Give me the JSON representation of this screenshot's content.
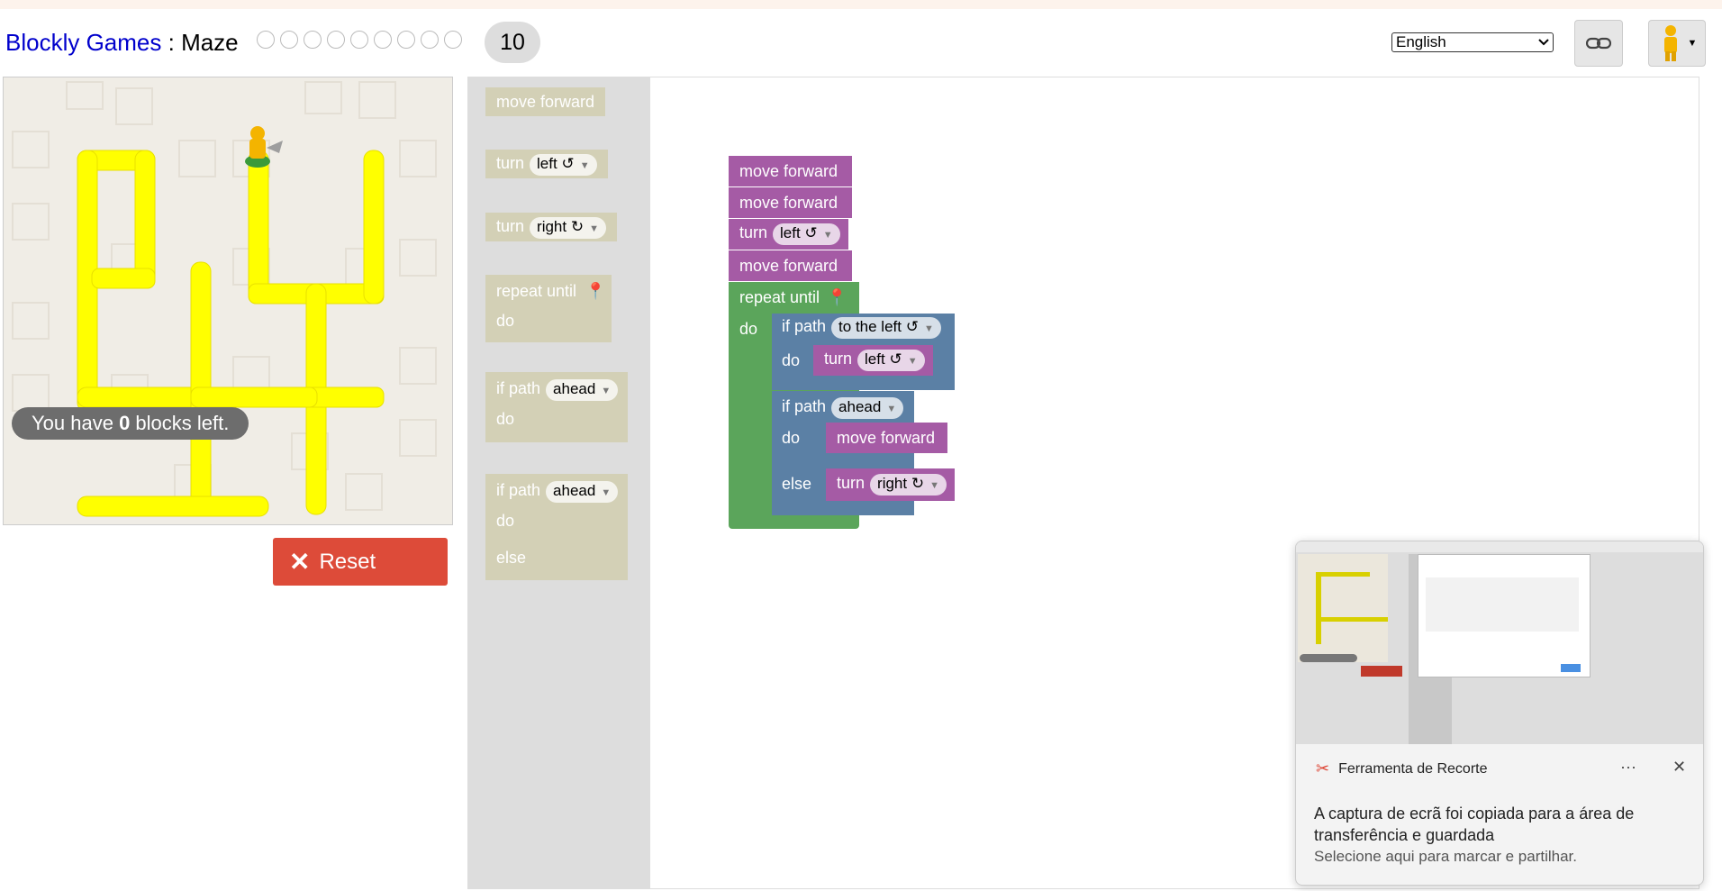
{
  "header": {
    "app_link": "Blockly Games",
    "separator": " : ",
    "game": "Maze",
    "level_dots": [
      "1",
      "2",
      "3",
      "4",
      "5",
      "6",
      "7",
      "8",
      "9"
    ],
    "current_level": "10",
    "language": "English",
    "link_icon": "link-icon",
    "pegman_icon": "pegman-icon"
  },
  "maze": {
    "blocks_left_prefix": "You have ",
    "blocks_left_count": "0",
    "blocks_left_suffix": " blocks left.",
    "reset_label": "Reset",
    "path_color": "#ffff00",
    "background_color": "#f0ede6"
  },
  "toolbox": {
    "move_forward": "move forward",
    "turn": "turn",
    "left": "left ↺",
    "right": "right ↻",
    "repeat_until": "repeat until",
    "do": "do",
    "if_path": "if path",
    "ahead": "ahead",
    "else": "else"
  },
  "program": {
    "move_forward_1": "move forward",
    "move_forward_2": "move forward",
    "turn_label": "turn",
    "turn_dir": "left ↺",
    "move_forward_3": "move forward",
    "repeat_until": "repeat until",
    "do": "do",
    "if1_label": "if path",
    "if1_dir": "to the left ↺",
    "if1_do": "do",
    "if1_turn": "turn",
    "if1_turn_dir": "left ↺",
    "if2_label": "if path",
    "if2_dir": "ahead",
    "if2_do": "do",
    "if2_move": "move forward",
    "if2_else": "else",
    "if2_turn": "turn",
    "if2_turn_dir": "right ↻"
  },
  "colors": {
    "motion": "#a55ba5",
    "loop": "#5ba55b",
    "logic": "#5b80a5",
    "reset": "#dd4b39"
  },
  "notification": {
    "app_name": "Ferramenta de Recorte",
    "message": "A captura de ecrã foi copiada para a área de transferência e guardada",
    "sub_message": "Selecione aqui para marcar e partilhar.",
    "more_icon": "more-icon",
    "close_icon": "close-icon"
  }
}
